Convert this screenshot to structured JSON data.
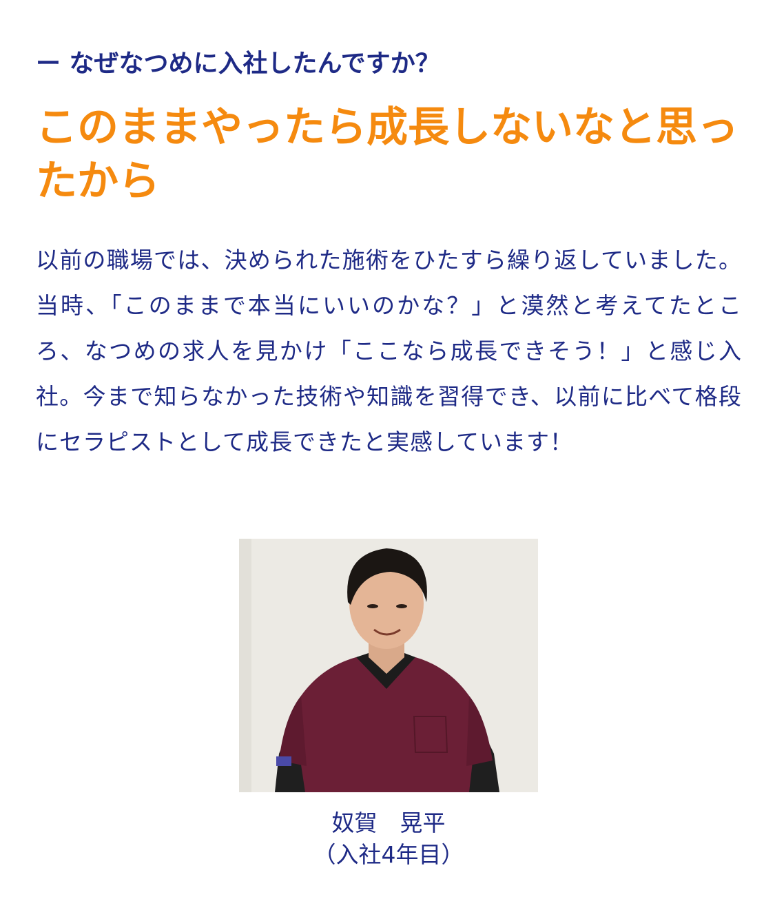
{
  "interview": {
    "question": "ー なぜなつめに入社したんですか？",
    "headline": "このままやったら成長しないなと思ったから",
    "body": "以前の職場では、決められた施術をひたすら繰り返していました。当時、「このままで本当にいいのかな？」と漠然と考えてたところ、なつめの求人を見かけ「ここなら成長できそう！」と感じ入社。今まで知らなかった技術や知識を習得でき、以前に比べて格段にセラピストとして成長できたと実感しています！"
  },
  "staff": {
    "name": "奴賀　晃平",
    "tenure": "（入社4年目）"
  },
  "colors": {
    "navy": "#1e2a86",
    "orange": "#f58a0f"
  }
}
